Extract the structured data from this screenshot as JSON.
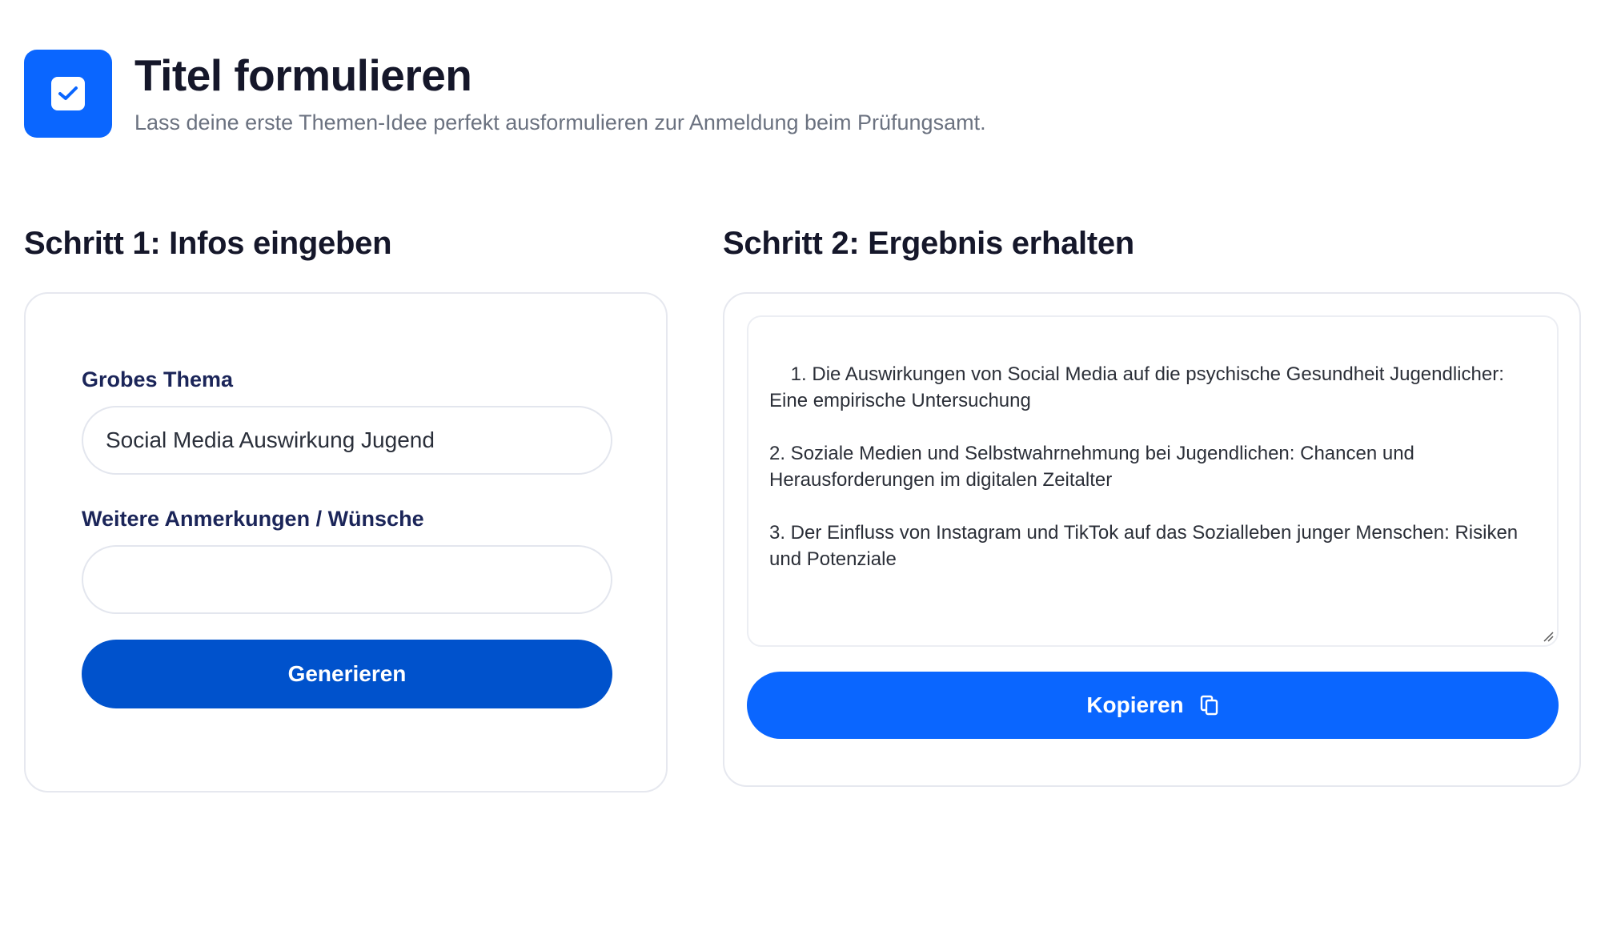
{
  "header": {
    "title": "Titel formulieren",
    "subtitle": "Lass deine erste Themen-Idee perfekt ausformulieren zur Anmeldung beim Prüfungsamt.",
    "logo_icon": "checkbox-icon"
  },
  "step1": {
    "title": "Schritt 1: Infos eingeben",
    "topic_label": "Grobes Thema",
    "topic_value": "Social Media Auswirkung Jugend",
    "notes_label": "Weitere Anmerkungen / Wünsche",
    "notes_value": "",
    "generate_label": "Generieren"
  },
  "step2": {
    "title": "Schritt 2: Ergebnis erhalten",
    "result_text": "1. Die Auswirkungen von Social Media auf die psychische Gesundheit Jugendlicher: Eine empirische Untersuchung\n\n2. Soziale Medien und Selbstwahrnehmung bei Jugendlichen: Chancen und Herausforderungen im digitalen Zeitalter\n\n3. Der Einfluss von Instagram und TikTok auf das Sozialleben junger Menschen: Risiken und Potenziale",
    "copy_label": "Kopieren",
    "copy_icon": "copy-icon"
  },
  "colors": {
    "accent": "#0a66ff",
    "generate_button": "#0052cc",
    "title_text": "#15172a",
    "subtitle_text": "#6b7280"
  }
}
